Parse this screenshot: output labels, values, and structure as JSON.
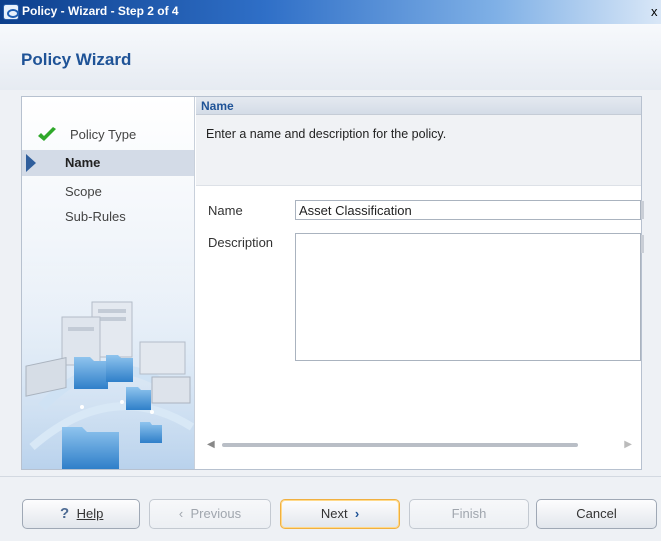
{
  "window": {
    "title": "Policy - Wizard - Step 2 of 4",
    "close_glyph": "x"
  },
  "wizard": {
    "title": "Policy Wizard"
  },
  "steps": [
    {
      "label": "Policy Type",
      "state": "done"
    },
    {
      "label": "Name",
      "state": "active"
    },
    {
      "label": "Scope",
      "state": "pending"
    },
    {
      "label": "Sub-Rules",
      "state": "pending"
    }
  ],
  "panel": {
    "section_title": "Name",
    "instructions": "Enter a name and description for the policy.",
    "name_label": "Name",
    "name_value": "Asset Classification",
    "description_label": "Description",
    "description_value": ""
  },
  "buttons": {
    "help": "Help",
    "previous": "Previous",
    "next": "Next",
    "finish": "Finish",
    "cancel": "Cancel"
  },
  "colors": {
    "accent": "#1f5397",
    "check": "#2fa82a",
    "primary_border": "#f0b040"
  }
}
